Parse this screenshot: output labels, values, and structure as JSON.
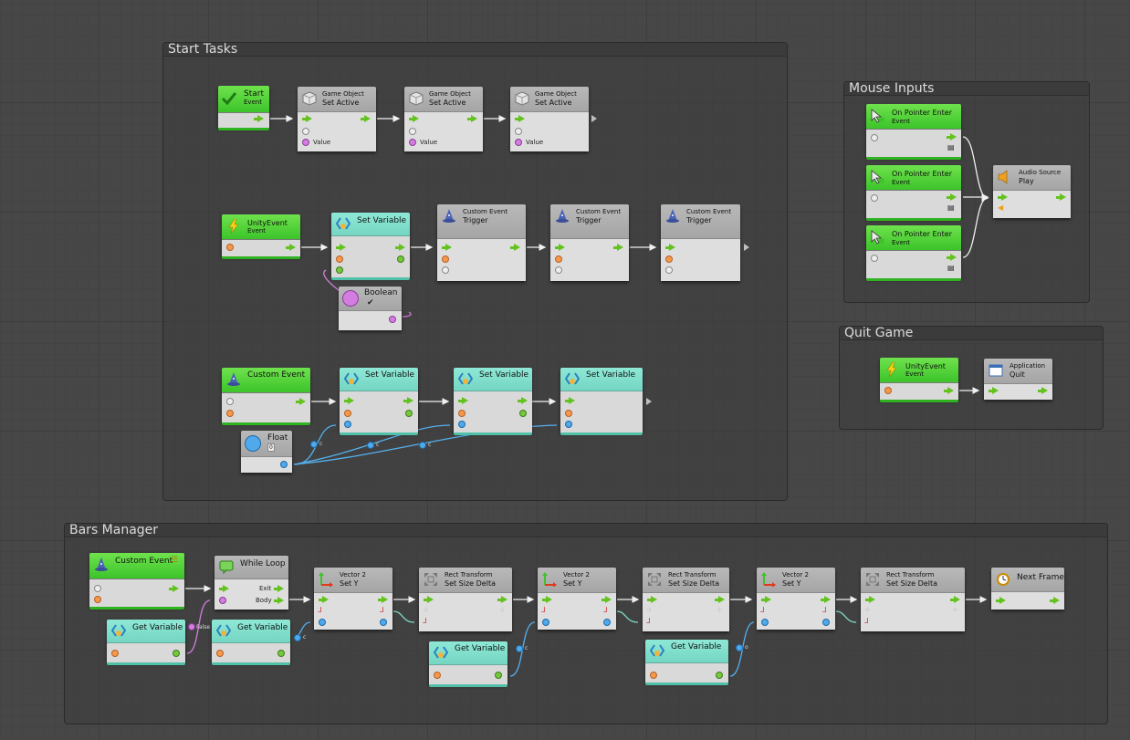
{
  "groups": {
    "start_tasks": "Start Tasks",
    "mouse_inputs": "Mouse Inputs",
    "quit_game": "Quit Game",
    "bars_manager": "Bars Manager"
  },
  "nodes": {
    "start_event": {
      "line1": "Start",
      "line2": "Event"
    },
    "set_active_1": {
      "line1": "Game Object",
      "line2": "Set Active",
      "port": "Value"
    },
    "set_active_2": {
      "line1": "Game Object",
      "line2": "Set Active",
      "port": "Value"
    },
    "set_active_3": {
      "line1": "Game Object",
      "line2": "Set Active",
      "port": "Value"
    },
    "unity_event_1": {
      "line1": "UnityEvent",
      "line2": "Event"
    },
    "set_variable_1": {
      "title": "Set Variable"
    },
    "trigger_1": {
      "line1": "Custom Event",
      "line2": "Trigger"
    },
    "trigger_2": {
      "line1": "Custom Event",
      "line2": "Trigger"
    },
    "trigger_3": {
      "line1": "Custom Event",
      "line2": "Trigger"
    },
    "boolean": {
      "title": "Boolean"
    },
    "custom_event_1": {
      "title": "Custom Event"
    },
    "set_variable_2": {
      "title": "Set Variable"
    },
    "set_variable_3": {
      "title": "Set Variable"
    },
    "set_variable_4": {
      "title": "Set Variable"
    },
    "float": {
      "title": "Float",
      "value": "0"
    },
    "pointer_enter_1": {
      "line1": "On Pointer Enter",
      "line2": "Event"
    },
    "pointer_enter_2": {
      "line1": "On Pointer Enter",
      "line2": "Event"
    },
    "pointer_enter_3": {
      "line1": "On Pointer Enter",
      "line2": "Event"
    },
    "audio_play": {
      "line1": "Audio Source",
      "line2": "Play"
    },
    "unity_event_2": {
      "line1": "UnityEvent",
      "line2": "Event"
    },
    "app_quit": {
      "line1": "Application",
      "line2": "Quit"
    },
    "custom_event_2": {
      "title": "Custom Event"
    },
    "while_loop": {
      "title": "While Loop",
      "exit": "Exit",
      "body": "Body"
    },
    "get_variable_1": {
      "title": "Get Variable"
    },
    "get_variable_2": {
      "title": "Get Variable"
    },
    "get_variable_3": {
      "title": "Get Variable"
    },
    "get_variable_4": {
      "title": "Get Variable"
    },
    "vec2_set_y_1": {
      "line1": "Vector 2",
      "line2": "Set Y"
    },
    "rect_size_1": {
      "line1": "Rect Transform",
      "line2": "Set Size Delta"
    },
    "vec2_set_y_2": {
      "line1": "Vector 2",
      "line2": "Set Y"
    },
    "rect_size_2": {
      "line1": "Rect Transform",
      "line2": "Set Size Delta"
    },
    "vec2_set_y_3": {
      "line1": "Vector 2",
      "line2": "Set Y"
    },
    "rect_size_3": {
      "line1": "Rect Transform",
      "line2": "Set Size Delta"
    },
    "next_frame": {
      "title": "Next Frame"
    }
  },
  "tags": {
    "float_c1": "c",
    "float_c2": "c",
    "float_c3": "c",
    "false": "False",
    "gv_c1": "c",
    "gv_c2": "c",
    "gv_c3": "c",
    "gv_o": "o"
  },
  "colors": {
    "event_header": "#3cc42a",
    "variable_header": "#74d6c2",
    "action_header": "#a5a5a5",
    "background": "#474747"
  }
}
